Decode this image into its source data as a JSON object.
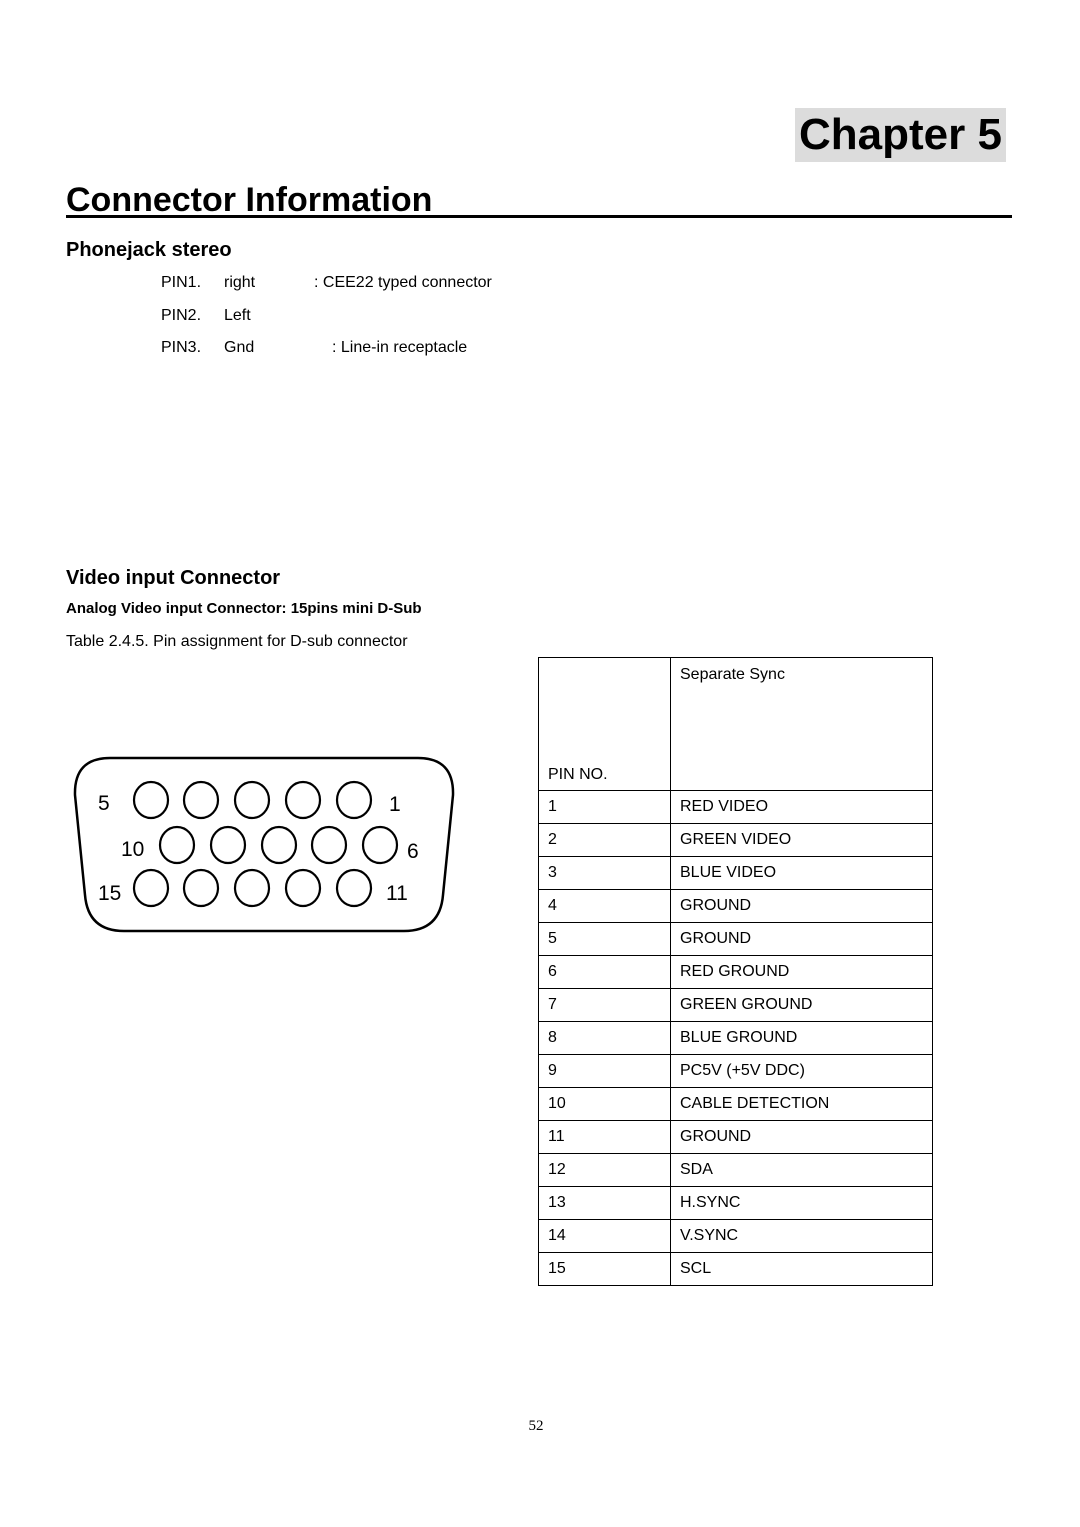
{
  "chapter_label": "Chapter 5",
  "title": "Connector Information",
  "phonejack": {
    "heading": "Phonejack stereo",
    "pins": [
      {
        "pin": "PIN1.",
        "name": "right",
        "note": ": CEE22 typed connector"
      },
      {
        "pin": "PIN2.",
        "name": "Left",
        "note": ""
      },
      {
        "pin": "PIN3.",
        "name": "Gnd",
        "note": ": Line-in receptacle"
      }
    ]
  },
  "video": {
    "heading": "Video input Connector",
    "subheading": "Analog Video input Connector: 15pins mini D-Sub",
    "caption": "Table 2.4.5. Pin assignment for D-sub connector",
    "diagram_labels": {
      "row1_left": "5",
      "row1_right": "1",
      "row2_left": "10",
      "row2_right": "6",
      "row3_left": "15",
      "row3_right": "11"
    },
    "table": {
      "header_pin": "PIN NO.",
      "header_signal": "Separate Sync",
      "rows": [
        {
          "pin": "1",
          "signal": "RED VIDEO"
        },
        {
          "pin": "2",
          "signal": "GREEN VIDEO"
        },
        {
          "pin": "3",
          "signal": "BLUE VIDEO"
        },
        {
          "pin": "4",
          "signal": "GROUND"
        },
        {
          "pin": "5",
          "signal": "GROUND"
        },
        {
          "pin": "6",
          "signal": "RED GROUND"
        },
        {
          "pin": "7",
          "signal": "GREEN GROUND"
        },
        {
          "pin": "8",
          "signal": "BLUE GROUND"
        },
        {
          "pin": "9",
          "signal": "PC5V (+5V DDC)"
        },
        {
          "pin": "10",
          "signal": "CABLE DETECTION"
        },
        {
          "pin": "11",
          "signal": "GROUND"
        },
        {
          "pin": "12",
          "signal": "SDA"
        },
        {
          "pin": "13",
          "signal": "H.SYNC"
        },
        {
          "pin": "14",
          "signal": "V.SYNC"
        },
        {
          "pin": "15",
          "signal": "SCL"
        }
      ]
    }
  },
  "page_number": "52"
}
